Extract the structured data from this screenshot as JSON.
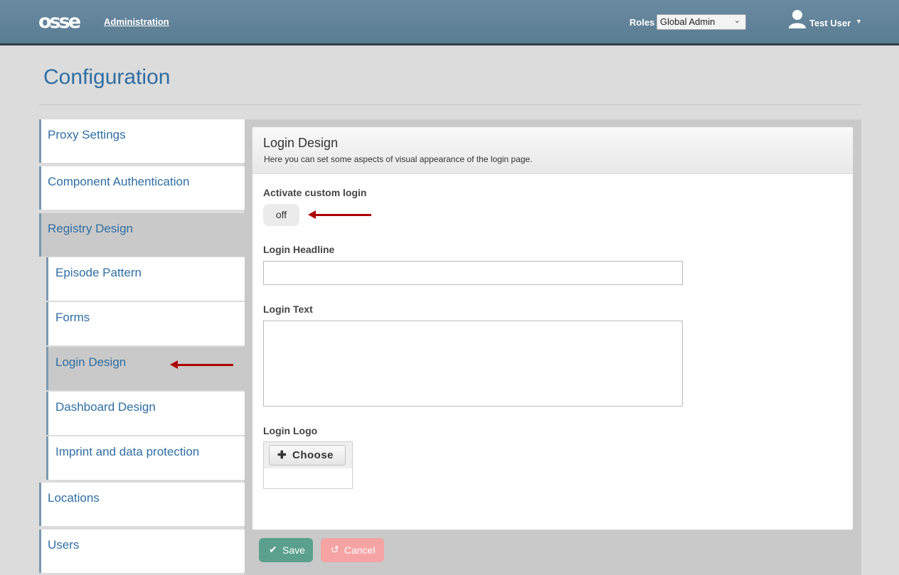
{
  "header": {
    "logo": "osse",
    "nav_link": "Administration",
    "roles_label": "Roles",
    "roles_selected": "Global Admin",
    "user_name": "Test User"
  },
  "page_title": "Configuration",
  "sidebar": {
    "items": [
      {
        "label": "Proxy Settings"
      },
      {
        "label": "Component Authentication"
      },
      {
        "label": "Registry Design"
      },
      {
        "label": "Episode Pattern"
      },
      {
        "label": "Forms"
      },
      {
        "label": "Login Design"
      },
      {
        "label": "Dashboard Design"
      },
      {
        "label": "Imprint and data protection"
      },
      {
        "label": "Locations"
      },
      {
        "label": "Users"
      }
    ]
  },
  "panel": {
    "title": "Login Design",
    "subtitle": "Here you can set some aspects of visual appearance of the login page.",
    "activate_label": "Activate custom login",
    "activate_value": "off",
    "headline_label": "Login Headline",
    "headline_value": "",
    "text_label": "Login Text",
    "text_value": "",
    "logo_label": "Login Logo",
    "choose_label": "Choose"
  },
  "actions": {
    "save": "Save",
    "cancel": "Cancel"
  },
  "colors": {
    "header": "#5a7d94",
    "link_blue": "#2f6ea3",
    "save_green": "#5aa08c",
    "cancel_red": "#f5a3a3",
    "annotation_red": "#b00000"
  }
}
